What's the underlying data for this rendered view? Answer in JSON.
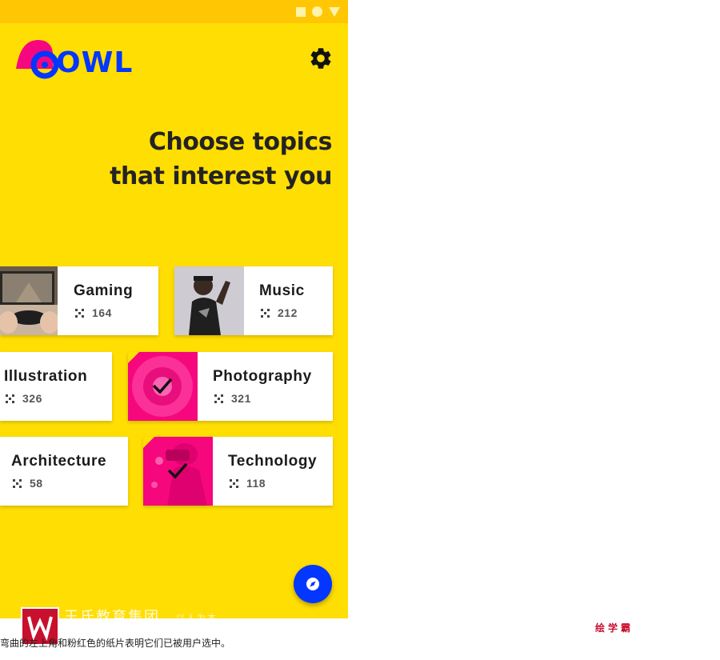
{
  "app": {
    "logo_text": "OWL",
    "brand_blue": "#0336FF",
    "brand_pink": "#F6077E",
    "brand_yellow": "#FFDE03"
  },
  "status_bar": {
    "icons": [
      "square-icon",
      "circle-icon",
      "triangle-icon"
    ]
  },
  "header": {
    "settings_icon": "gear-icon"
  },
  "title": {
    "line1": "Choose topics",
    "line2": "that interest you"
  },
  "topics": [
    {
      "name": "Gaming",
      "count": "164",
      "selected": false
    },
    {
      "name": "Music",
      "count": "212",
      "selected": false
    },
    {
      "name": "Illustration",
      "count": "326",
      "selected": false
    },
    {
      "name": "Photography",
      "count": "321",
      "selected": true
    },
    {
      "name": "Architecture",
      "count": "58",
      "selected": false
    },
    {
      "name": "Technology",
      "count": "118",
      "selected": true
    }
  ],
  "fab": {
    "icon": "compass-icon"
  },
  "watermark": {
    "org": "王氏教育集团",
    "slogan": "以人为本",
    "brand_right": "绘学霸"
  },
  "caption": "弯曲的左上角和粉红色的纸片表明它们已被用户选中。"
}
